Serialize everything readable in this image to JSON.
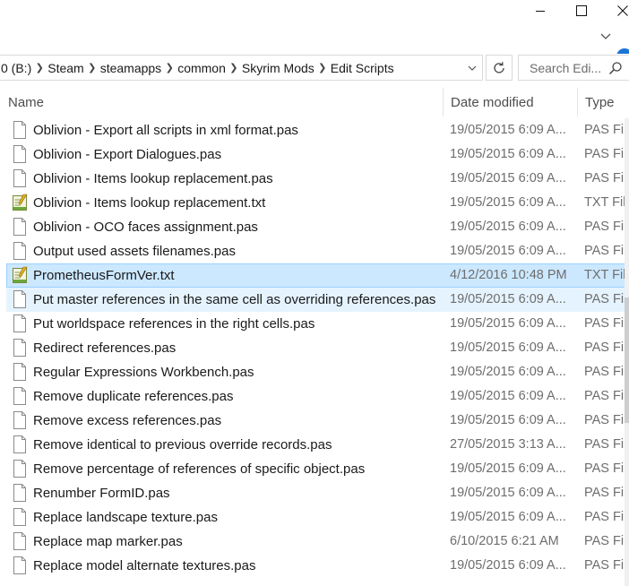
{
  "window": {
    "minimize_icon": "minimize-icon",
    "maximize_icon": "maximize-icon",
    "close_icon": "close-icon"
  },
  "address": {
    "crumbs": [
      "0 (B:)",
      "Steam",
      "steamapps",
      "common",
      "Skyrim Mods",
      "Edit Scripts"
    ]
  },
  "search": {
    "placeholder": "Search Edi..."
  },
  "columns": {
    "name": "Name",
    "date": "Date modified",
    "type": "Type"
  },
  "files": [
    {
      "name": "Oblivion - Export all scripts in xml format.pas",
      "date": "19/05/2015 6:09 A...",
      "type": "PAS Fil",
      "icon": "pas-file-icon"
    },
    {
      "name": "Oblivion - Export Dialogues.pas",
      "date": "19/05/2015 6:09 A...",
      "type": "PAS Fil",
      "icon": "pas-file-icon"
    },
    {
      "name": "Oblivion - Items lookup replacement.pas",
      "date": "19/05/2015 6:09 A...",
      "type": "PAS Fil",
      "icon": "pas-file-icon"
    },
    {
      "name": "Oblivion - Items lookup replacement.txt",
      "date": "19/05/2015 6:09 A...",
      "type": "TXT Fil",
      "icon": "txt-file-icon"
    },
    {
      "name": "Oblivion - OCO faces assignment.pas",
      "date": "19/05/2015 6:09 A...",
      "type": "PAS Fil",
      "icon": "pas-file-icon"
    },
    {
      "name": "Output used assets filenames.pas",
      "date": "19/05/2015 6:09 A...",
      "type": "PAS Fil",
      "icon": "pas-file-icon"
    },
    {
      "name": "PrometheusFormVer.txt",
      "date": "4/12/2016 10:48 PM",
      "type": "TXT Fil",
      "icon": "txt-file-icon"
    },
    {
      "name": "Put master references in the same cell as overriding references.pas",
      "date": "19/05/2015 6:09 A...",
      "type": "PAS Fil",
      "icon": "pas-file-icon"
    },
    {
      "name": "Put worldspace references in the right cells.pas",
      "date": "19/05/2015 6:09 A...",
      "type": "PAS Fil",
      "icon": "pas-file-icon"
    },
    {
      "name": "Redirect references.pas",
      "date": "19/05/2015 6:09 A...",
      "type": "PAS Fil",
      "icon": "pas-file-icon"
    },
    {
      "name": "Regular Expressions Workbench.pas",
      "date": "19/05/2015 6:09 A...",
      "type": "PAS Fil",
      "icon": "pas-file-icon"
    },
    {
      "name": "Remove duplicate references.pas",
      "date": "19/05/2015 6:09 A...",
      "type": "PAS Fil",
      "icon": "pas-file-icon"
    },
    {
      "name": "Remove excess references.pas",
      "date": "19/05/2015 6:09 A...",
      "type": "PAS Fil",
      "icon": "pas-file-icon"
    },
    {
      "name": "Remove identical to previous override records.pas",
      "date": "27/05/2015 3:13 A...",
      "type": "PAS Fil",
      "icon": "pas-file-icon"
    },
    {
      "name": "Remove percentage of references of specific object.pas",
      "date": "19/05/2015 6:09 A...",
      "type": "PAS Fil",
      "icon": "pas-file-icon"
    },
    {
      "name": "Renumber FormID.pas",
      "date": "19/05/2015 6:09 A...",
      "type": "PAS Fil",
      "icon": "pas-file-icon"
    },
    {
      "name": "Replace landscape texture.pas",
      "date": "19/05/2015 6:09 A...",
      "type": "PAS Fil",
      "icon": "pas-file-icon"
    },
    {
      "name": "Replace map marker.pas",
      "date": "6/10/2015 6:21 AM",
      "type": "PAS Fil",
      "icon": "pas-file-icon"
    },
    {
      "name": "Replace model alternate textures.pas",
      "date": "19/05/2015 6:09 A...",
      "type": "PAS Fil",
      "icon": "pas-file-icon"
    }
  ],
  "selected_index": 6,
  "hover_index": 7,
  "colors": {
    "selected_bg": "#cce8ff",
    "selected_border": "#99d1ff",
    "hover_bg": "#e5f3ff",
    "help_blue": "#1e74d6"
  }
}
